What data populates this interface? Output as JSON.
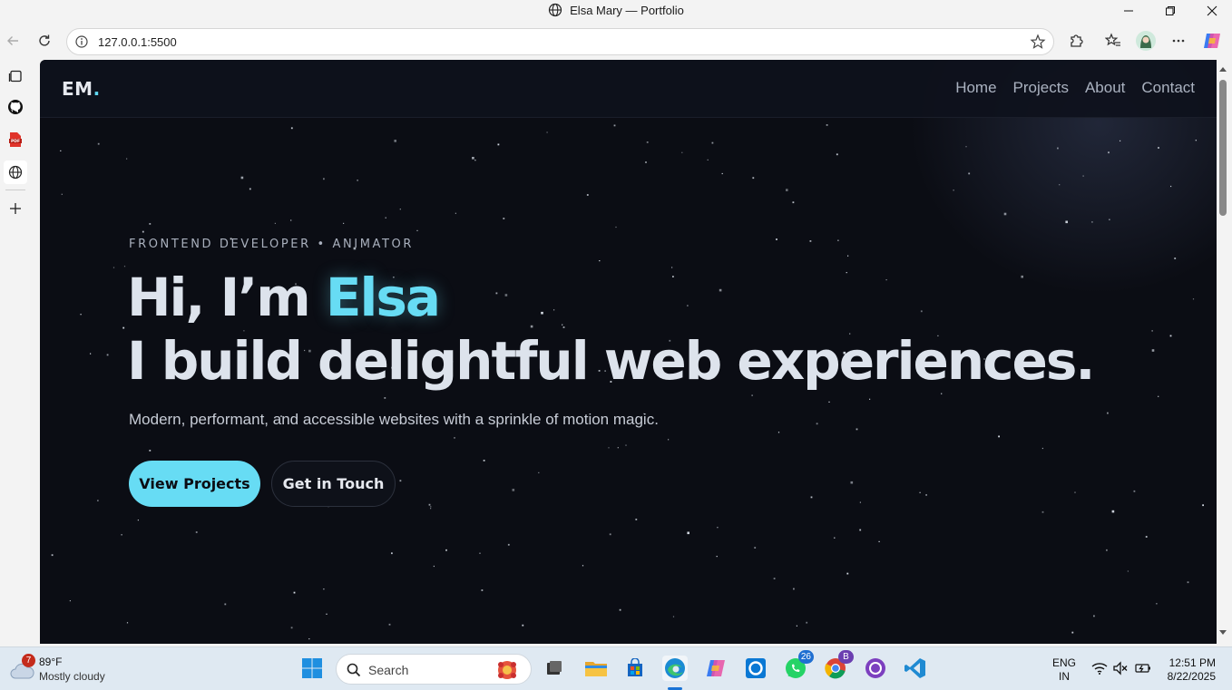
{
  "window": {
    "title": "Elsa Mary — Portfolio"
  },
  "browser": {
    "url": "127.0.0.1:5500"
  },
  "site": {
    "logo_text": "EM",
    "logo_dot": ".",
    "nav": [
      "Home",
      "Projects",
      "About",
      "Contact"
    ],
    "eyebrow": "FRONTEND DEVELOPER • ANIMATOR",
    "headline_prefix": "Hi, I’m ",
    "headline_name": "Elsa",
    "headline_line2": "I build delightful web experiences.",
    "subtitle": "Modern, performant, and accessible websites with a sprinkle of motion magic.",
    "primary_button": "View Projects",
    "secondary_button": "Get in Touch",
    "accent_color": "#67dcf4",
    "background_color": "#0b0d14"
  },
  "taskbar": {
    "weather_badge": "7",
    "temperature": "89°F",
    "condition": "Mostly cloudy",
    "search_placeholder": "Search",
    "whatsapp_count": "26",
    "chrome_profile": "B",
    "lang_line1": "ENG",
    "lang_line2": "IN",
    "time": "12:51 PM",
    "date": "8/22/2025"
  }
}
